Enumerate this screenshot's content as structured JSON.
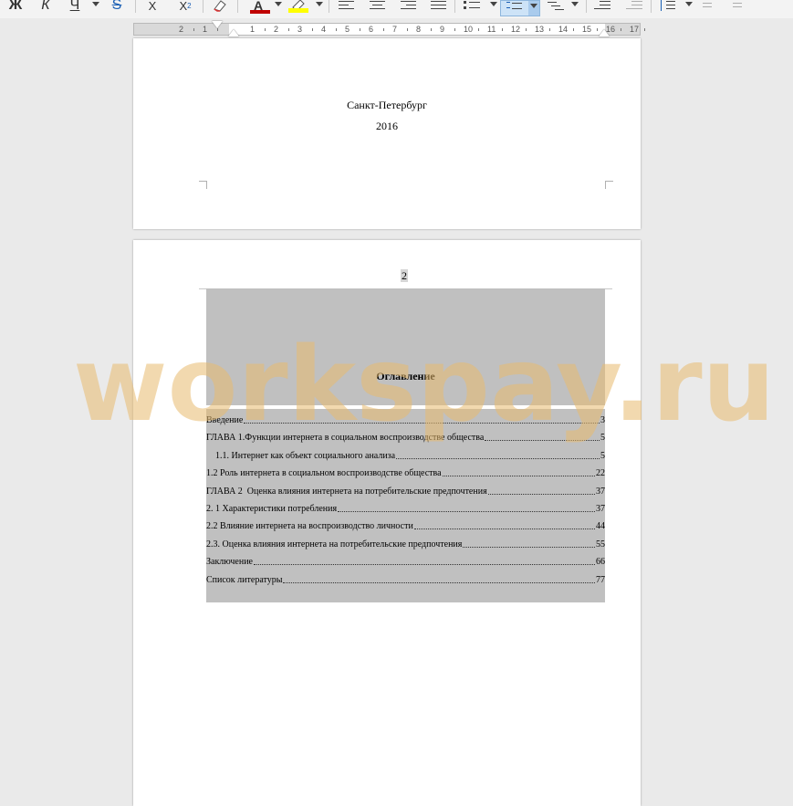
{
  "toolbar": {
    "bold_label": "Ж",
    "italic_label": "К",
    "underline_label": "Ч",
    "strike_label": "S",
    "superscript_label": "X",
    "subscript_label": "X",
    "subscript_index": "2",
    "font_color": "#c00000",
    "highlight_color": "#ffff00"
  },
  "ruler": {
    "numbers": [
      "2",
      "1",
      "1",
      "2",
      "3",
      "4",
      "5",
      "6",
      "7",
      "8",
      "9",
      "10",
      "11",
      "12",
      "13",
      "14",
      "15",
      "16",
      "17"
    ]
  },
  "page1": {
    "city": "Санкт-Петербург",
    "year": "2016"
  },
  "page2": {
    "header_number": "2",
    "toc_title": "Оглавление",
    "toc": [
      {
        "title": "Введение",
        "page": "3"
      },
      {
        "title": "ГЛАВА 1.Функции интернета в социальном воспроизводстве общества",
        "page": "5"
      },
      {
        "title": "1.1. Интернет как объект социального анализа",
        "page": "5",
        "indent": true
      },
      {
        "title": "1.2 Роль интернета в социальном воспроизводстве общества",
        "page": "22"
      },
      {
        "title": "ГЛАВА 2  Оценка влияния интернета на потребительские предпочтения",
        "page": "37"
      },
      {
        "title": "2. 1 Характеристики потребления",
        "page": "37"
      },
      {
        "title": "2.2 Влияние интернета на воспроизводство личности",
        "page": "44"
      },
      {
        "title": "2.3. Оценка влияния интернета на потребительские предпочтения",
        "page": "55"
      },
      {
        "title": "Заключение",
        "page": "66"
      },
      {
        "title": "Список литературы",
        "page": "77"
      }
    ]
  },
  "watermark": "workspay.ru"
}
